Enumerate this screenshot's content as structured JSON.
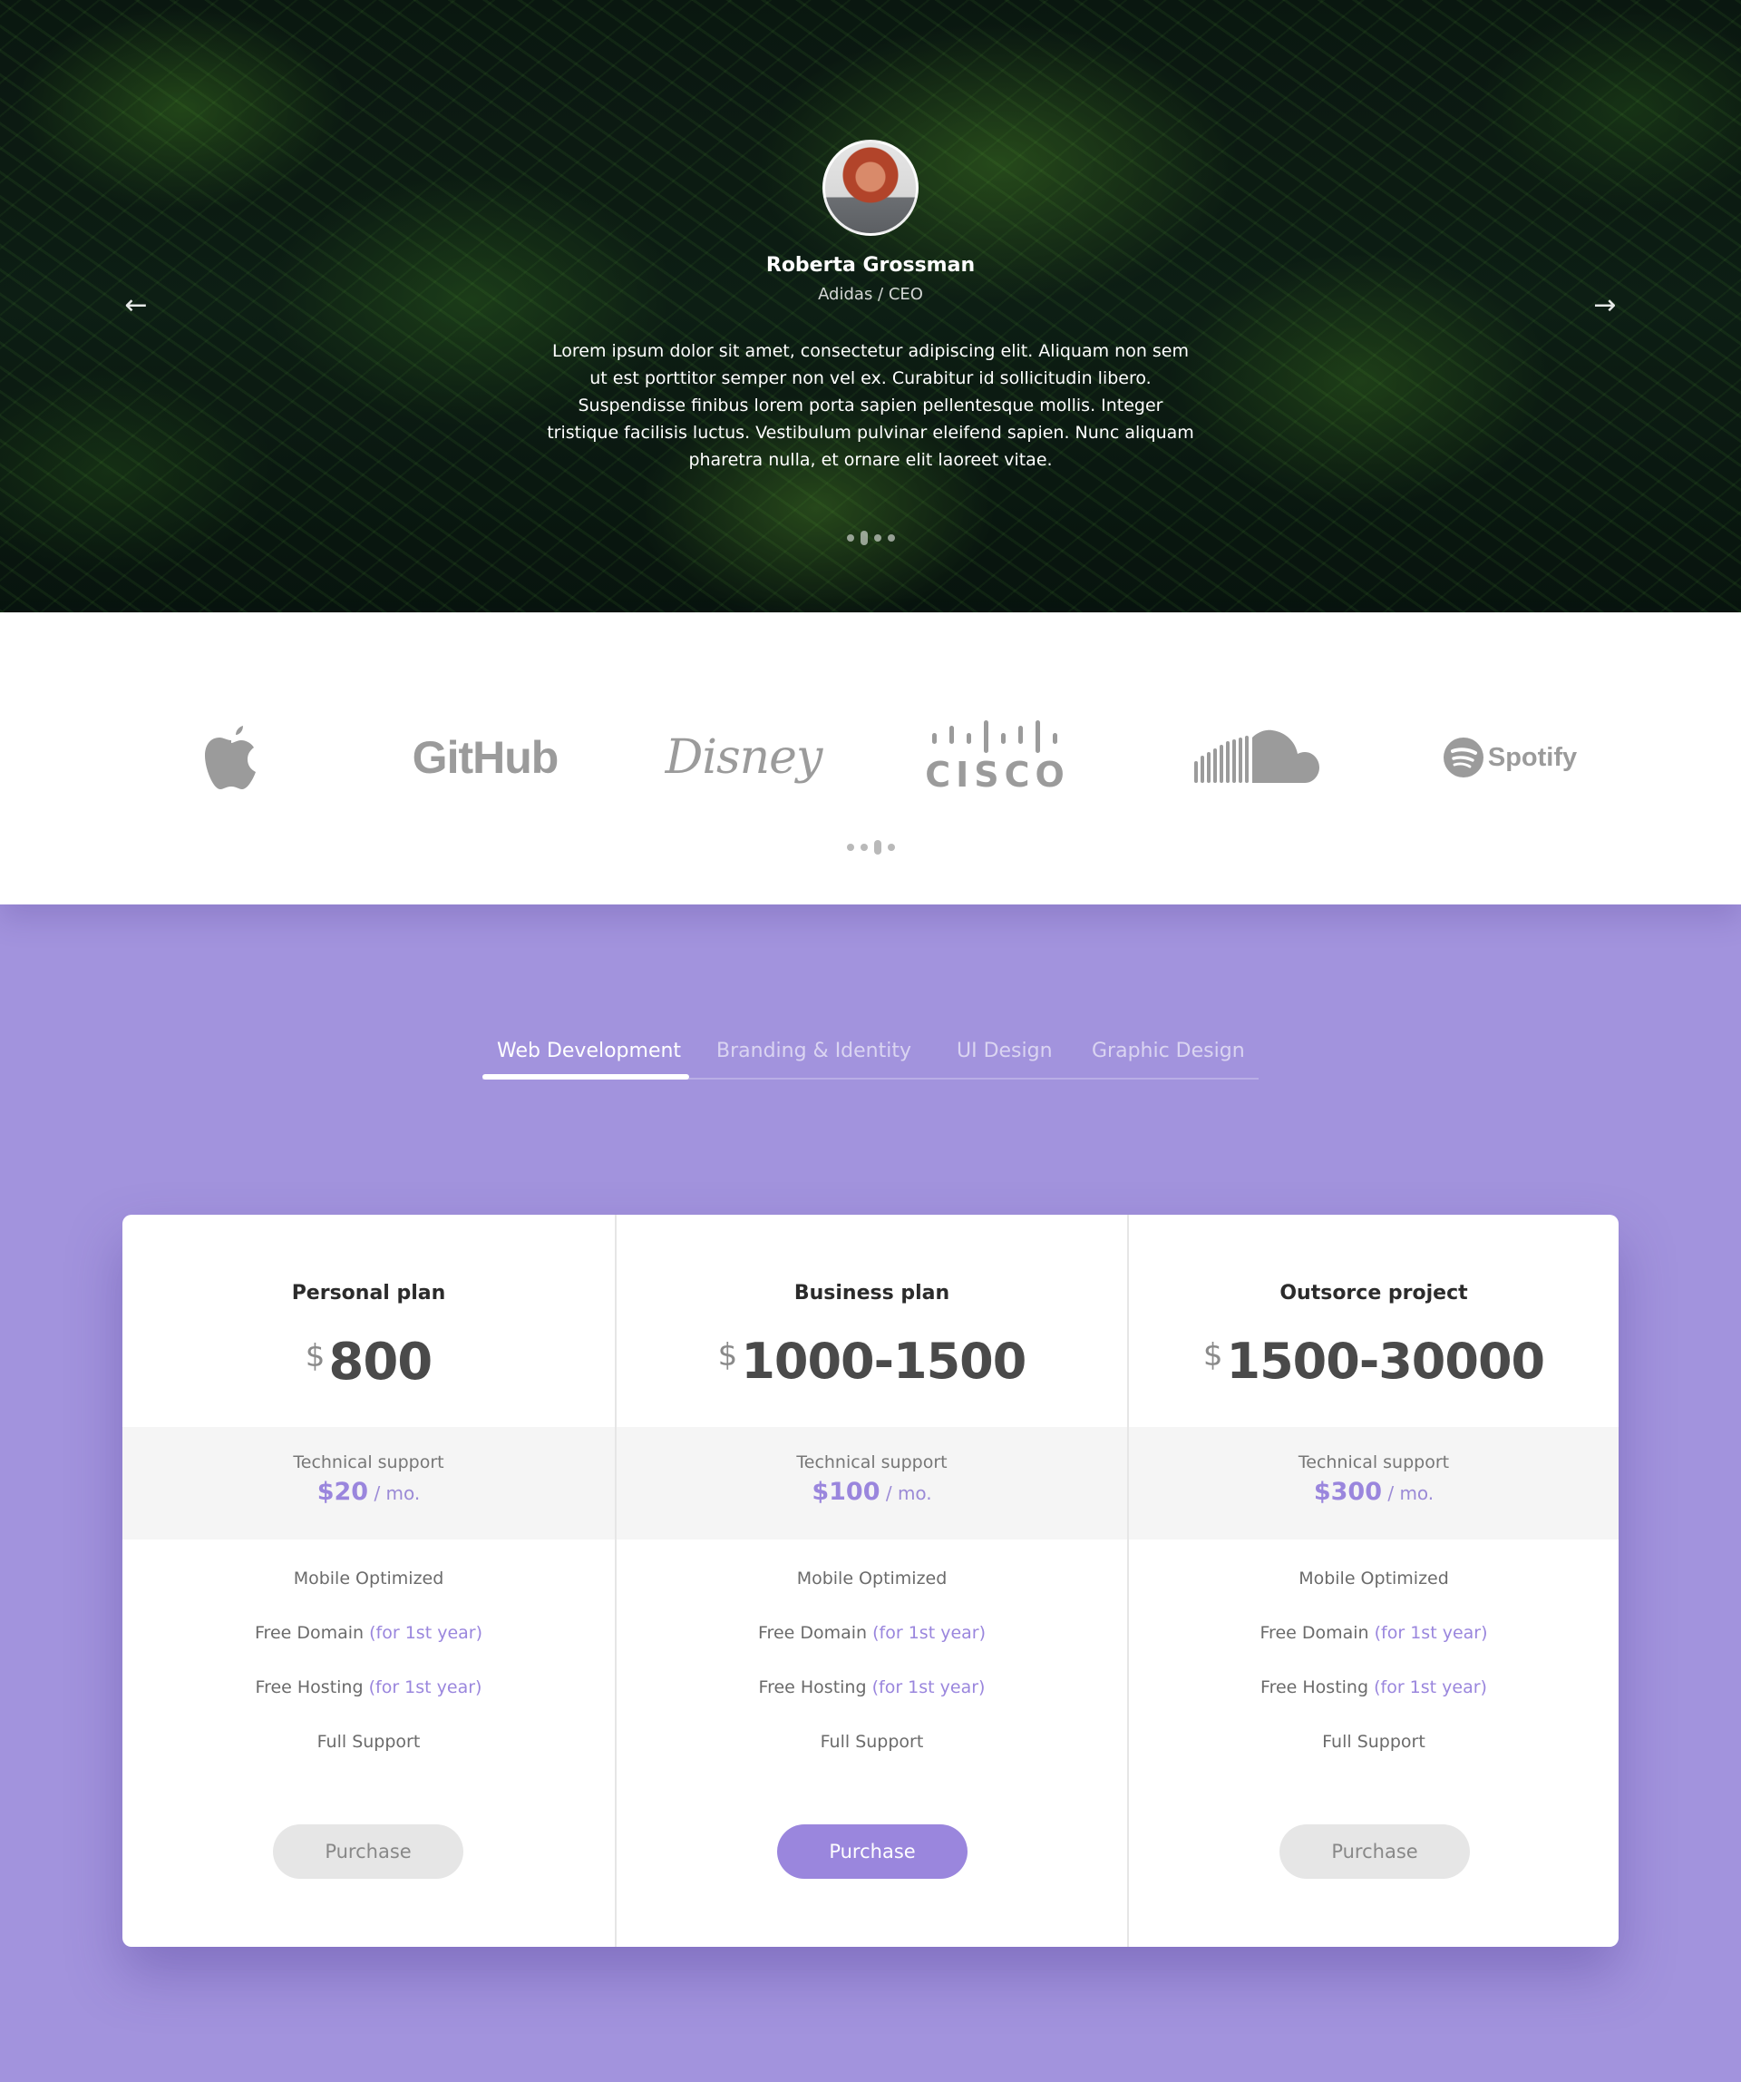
{
  "testimonial": {
    "name": "Roberta Grossman",
    "role": "Adidas / CEO",
    "quote": "Lorem ipsum dolor sit amet, consectetur adipiscing elit. Aliquam non sem ut est porttitor semper non vel ex. Curabitur id sollicitudin libero. Suspendisse finibus lorem porta sapien pellentesque mollis. Integer tristique facilisis luctus. Vestibulum pulvinar eleifend sapien. Nunc aliquam pharetra nulla, et ornare elit laoreet vitae.",
    "prev_arrow": "←",
    "next_arrow": "→",
    "slide_count": 4,
    "active_slide": 2
  },
  "logos": {
    "items": [
      "Apple",
      "GitHub",
      "Disney",
      "CISCO",
      "SoundCloud",
      "Spotify"
    ],
    "text": {
      "github": "GitHub",
      "disney": "Disney",
      "cisco": "CISCO",
      "spotify": "Spotify"
    },
    "slide_count": 4,
    "active_slide": 3
  },
  "tabs": [
    {
      "label": "Web Development",
      "active": true
    },
    {
      "label": "Branding & Identity",
      "active": false
    },
    {
      "label": "UI Design",
      "active": false
    },
    {
      "label": "Graphic Design",
      "active": false
    }
  ],
  "plans": [
    {
      "name": "Personal plan",
      "currency": "$",
      "price": "800",
      "support_label": "Technical support",
      "support_price": "$20",
      "support_period": " / mo.",
      "features": [
        {
          "text": "Mobile Optimized",
          "note": ""
        },
        {
          "text": "Free Domain",
          "note": "(for 1st year)"
        },
        {
          "text": "Free Hosting",
          "note": "(for 1st year)"
        },
        {
          "text": "Full Support",
          "note": ""
        }
      ],
      "button": "Purchase",
      "highlighted": false
    },
    {
      "name": "Business plan",
      "currency": "$",
      "price": "1000-1500",
      "support_label": "Technical support",
      "support_price": "$100",
      "support_period": " / mo.",
      "features": [
        {
          "text": "Mobile Optimized",
          "note": ""
        },
        {
          "text": "Free Domain",
          "note": "(for 1st year)"
        },
        {
          "text": "Free Hosting",
          "note": "(for 1st year)"
        },
        {
          "text": "Full Support",
          "note": ""
        }
      ],
      "button": "Purchase",
      "highlighted": true
    },
    {
      "name": "Outsorce project",
      "currency": "$",
      "price": "1500-30000",
      "support_label": "Technical support",
      "support_price": "$300",
      "support_period": " / mo.",
      "features": [
        {
          "text": "Mobile Optimized",
          "note": ""
        },
        {
          "text": "Free Domain",
          "note": "(for 1st year)"
        },
        {
          "text": "Free Hosting",
          "note": "(for 1st year)"
        },
        {
          "text": "Full Support",
          "note": ""
        }
      ],
      "button": "Purchase",
      "highlighted": false
    }
  ],
  "colors": {
    "accent": "#9a86dd",
    "section_bg": "#a293dd",
    "logo_gray": "#9b9b9b"
  }
}
